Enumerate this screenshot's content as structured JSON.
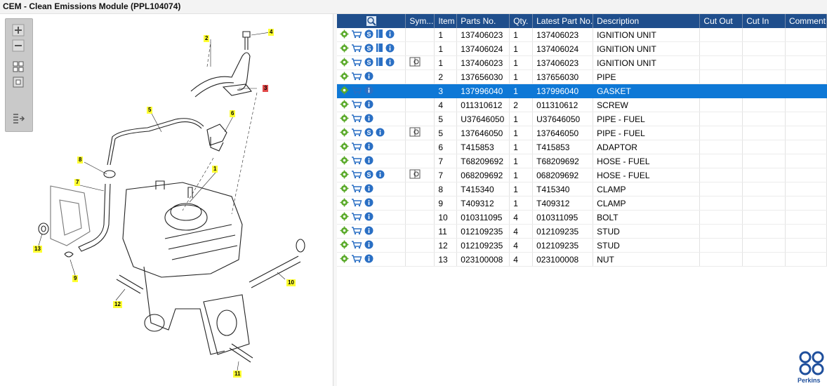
{
  "window": {
    "title": "CEM - Clean Emissions Module (PPL104074)"
  },
  "toolbox": {
    "buttons": [
      "zoom-in-icon",
      "zoom-out-icon",
      "fit-all-icon",
      "fit-window-icon",
      "export-list-icon"
    ]
  },
  "callouts": [
    {
      "label": "1"
    },
    {
      "label": "2"
    },
    {
      "label": "3"
    },
    {
      "label": "4"
    },
    {
      "label": "5"
    },
    {
      "label": "6"
    },
    {
      "label": "7"
    },
    {
      "label": "8"
    },
    {
      "label": "9"
    },
    {
      "label": "10"
    },
    {
      "label": "11"
    },
    {
      "label": "12"
    },
    {
      "label": "13"
    }
  ],
  "table": {
    "columns": [
      "",
      "Sym...",
      "Item",
      "Parts No.",
      "Qty.",
      "Latest Part No.",
      "Description",
      "Cut Out",
      "Cut In",
      "Comment"
    ],
    "rows": [
      {
        "icons": [
          "gear",
          "cart",
          "s",
          "book",
          "info"
        ],
        "sym": "",
        "item": "1",
        "part": "137406023",
        "qty": "1",
        "latest": "137406023",
        "desc": "IGNITION UNIT",
        "selected": false
      },
      {
        "icons": [
          "gear",
          "cart",
          "s",
          "book",
          "info"
        ],
        "sym": "",
        "item": "1",
        "part": "137406024",
        "qty": "1",
        "latest": "137406024",
        "desc": "IGNITION UNIT",
        "selected": false
      },
      {
        "icons": [
          "gear",
          "cart",
          "s",
          "book",
          "info"
        ],
        "sym": "book",
        "item": "1",
        "part": "137406023",
        "qty": "1",
        "latest": "137406023",
        "desc": "IGNITION UNIT",
        "selected": false
      },
      {
        "icons": [
          "gear",
          "cart",
          "info"
        ],
        "sym": "",
        "item": "2",
        "part": "137656030",
        "qty": "1",
        "latest": "137656030",
        "desc": "PIPE",
        "selected": false
      },
      {
        "icons": [
          "gear",
          "cart",
          "info"
        ],
        "sym": "",
        "item": "3",
        "part": "137996040",
        "qty": "1",
        "latest": "137996040",
        "desc": "GASKET",
        "selected": true
      },
      {
        "icons": [
          "gear",
          "cart",
          "info"
        ],
        "sym": "",
        "item": "4",
        "part": "011310612",
        "qty": "2",
        "latest": "011310612",
        "desc": "SCREW",
        "selected": false
      },
      {
        "icons": [
          "gear",
          "cart",
          "info"
        ],
        "sym": "",
        "item": "5",
        "part": "U37646050",
        "qty": "1",
        "latest": "U37646050",
        "desc": "PIPE - FUEL",
        "selected": false
      },
      {
        "icons": [
          "gear",
          "cart",
          "s",
          "info"
        ],
        "sym": "book",
        "item": "5",
        "part": "137646050",
        "qty": "1",
        "latest": "137646050",
        "desc": "PIPE - FUEL",
        "selected": false
      },
      {
        "icons": [
          "gear",
          "cart",
          "info"
        ],
        "sym": "",
        "item": "6",
        "part": "T415853",
        "qty": "1",
        "latest": "T415853",
        "desc": "ADAPTOR",
        "selected": false
      },
      {
        "icons": [
          "gear",
          "cart",
          "info"
        ],
        "sym": "",
        "item": "7",
        "part": "T68209692",
        "qty": "1",
        "latest": "T68209692",
        "desc": "HOSE - FUEL",
        "selected": false
      },
      {
        "icons": [
          "gear",
          "cart",
          "s",
          "info"
        ],
        "sym": "book",
        "item": "7",
        "part": "068209692",
        "qty": "1",
        "latest": "068209692",
        "desc": "HOSE - FUEL",
        "selected": false
      },
      {
        "icons": [
          "gear",
          "cart",
          "info"
        ],
        "sym": "",
        "item": "8",
        "part": "T415340",
        "qty": "1",
        "latest": "T415340",
        "desc": "CLAMP",
        "selected": false
      },
      {
        "icons": [
          "gear",
          "cart",
          "info"
        ],
        "sym": "",
        "item": "9",
        "part": "T409312",
        "qty": "1",
        "latest": "T409312",
        "desc": "CLAMP",
        "selected": false
      },
      {
        "icons": [
          "gear",
          "cart",
          "info"
        ],
        "sym": "",
        "item": "10",
        "part": "010311095",
        "qty": "4",
        "latest": "010311095",
        "desc": "BOLT",
        "selected": false
      },
      {
        "icons": [
          "gear",
          "cart",
          "info"
        ],
        "sym": "",
        "item": "11",
        "part": "012109235",
        "qty": "4",
        "latest": "012109235",
        "desc": "STUD",
        "selected": false
      },
      {
        "icons": [
          "gear",
          "cart",
          "info"
        ],
        "sym": "",
        "item": "12",
        "part": "012109235",
        "qty": "4",
        "latest": "012109235",
        "desc": "STUD",
        "selected": false
      },
      {
        "icons": [
          "gear",
          "cart",
          "info"
        ],
        "sym": "",
        "item": "13",
        "part": "023100008",
        "qty": "4",
        "latest": "023100008",
        "desc": "NUT",
        "selected": false
      }
    ]
  },
  "brand": {
    "name": "Perkins",
    "color": "#1f4f9c"
  },
  "colors": {
    "header": "#1f4e8c",
    "selected_row": "#0e78d6",
    "callout": "#ffff33",
    "callout_highlight": "#e24a4a"
  }
}
